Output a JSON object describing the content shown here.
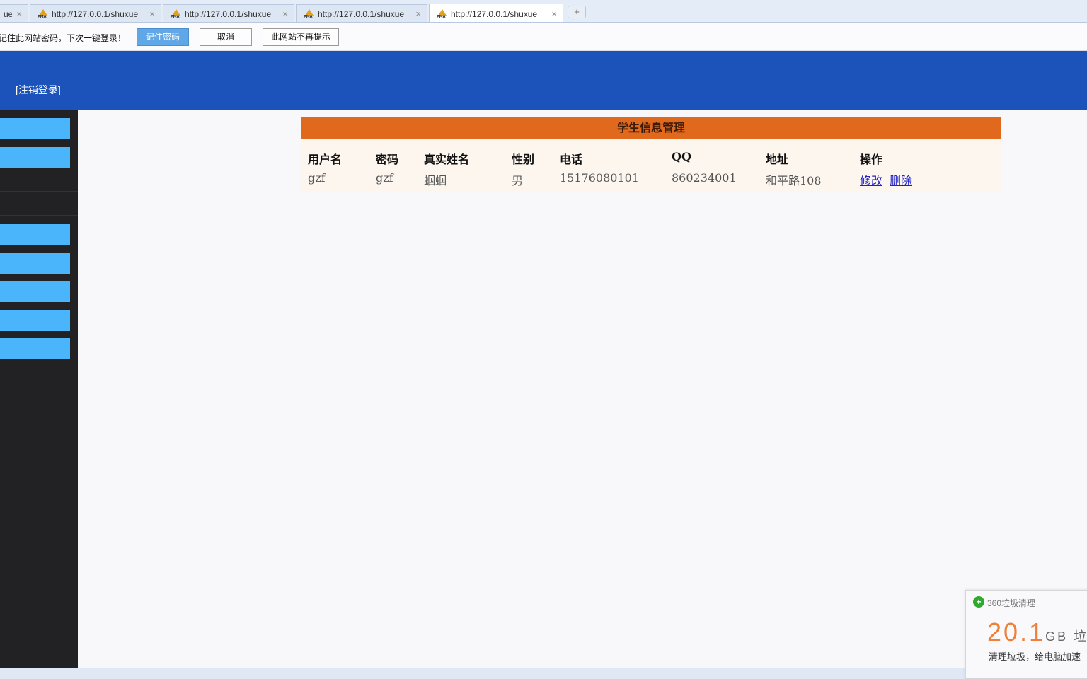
{
  "browser": {
    "tabs": [
      {
        "title": "ue"
      },
      {
        "title": "http://127.0.0.1/shuxue"
      },
      {
        "title": "http://127.0.0.1/shuxue"
      },
      {
        "title": "http://127.0.0.1/shuxue"
      },
      {
        "title": "http://127.0.0.1/shuxue"
      }
    ],
    "favicon_text": "PMA",
    "close_glyph": "×",
    "new_tab_glyph": "+"
  },
  "password_bar": {
    "message": "记住此网站密码，下次一键登录！",
    "remember_label": "记住密码",
    "cancel_label": "取消",
    "never_label": "此网站不再提示"
  },
  "header": {
    "logout": "[注销登录]"
  },
  "table": {
    "title": "学生信息管理",
    "columns": [
      "用户名",
      "密码",
      "真实姓名",
      "性别",
      "电话",
      "QQ",
      "地址",
      "操作"
    ],
    "rows": [
      {
        "username": "gzf",
        "password": "gzf",
        "realname": "蝈蝈",
        "gender": "男",
        "phone": "15176080101",
        "qq": "860234001",
        "address": "和平路108",
        "edit": "修改",
        "delete": "删除"
      }
    ]
  },
  "popup": {
    "icon": "+",
    "title": "360垃圾清理",
    "amount": "20.1",
    "unit": "GB 垃",
    "subtitle": "清理垃圾，给电脑加速"
  },
  "colors": {
    "header_blue": "#1c53bb",
    "sidebar_dark": "#222224",
    "sidebar_item": "#4bb5fb",
    "panel_orange": "#e1691e"
  }
}
